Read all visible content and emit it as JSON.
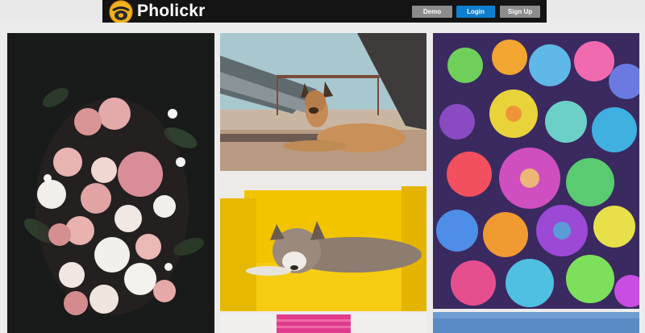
{
  "app": {
    "name": "Pholickr",
    "logo_icon": "camera-bowl-icon"
  },
  "nav": {
    "demo_label": "Demo",
    "login_label": "Login",
    "signup_label": "Sign Up"
  },
  "colors": {
    "navbar": "#141414",
    "login_button": "#0e7fd0",
    "secondary_button": "#8c8c8c",
    "page_background": "#ececec"
  },
  "gallery": {
    "photos": [
      {
        "subject": "pink-and-white-flower-bouquet"
      },
      {
        "subject": "dog-lying-under-bridge"
      },
      {
        "subject": "dog-on-yellow-armchair"
      },
      {
        "subject": "pink-knit-item"
      },
      {
        "subject": "rainbow-roses"
      },
      {
        "subject": "blue-sky"
      }
    ]
  }
}
